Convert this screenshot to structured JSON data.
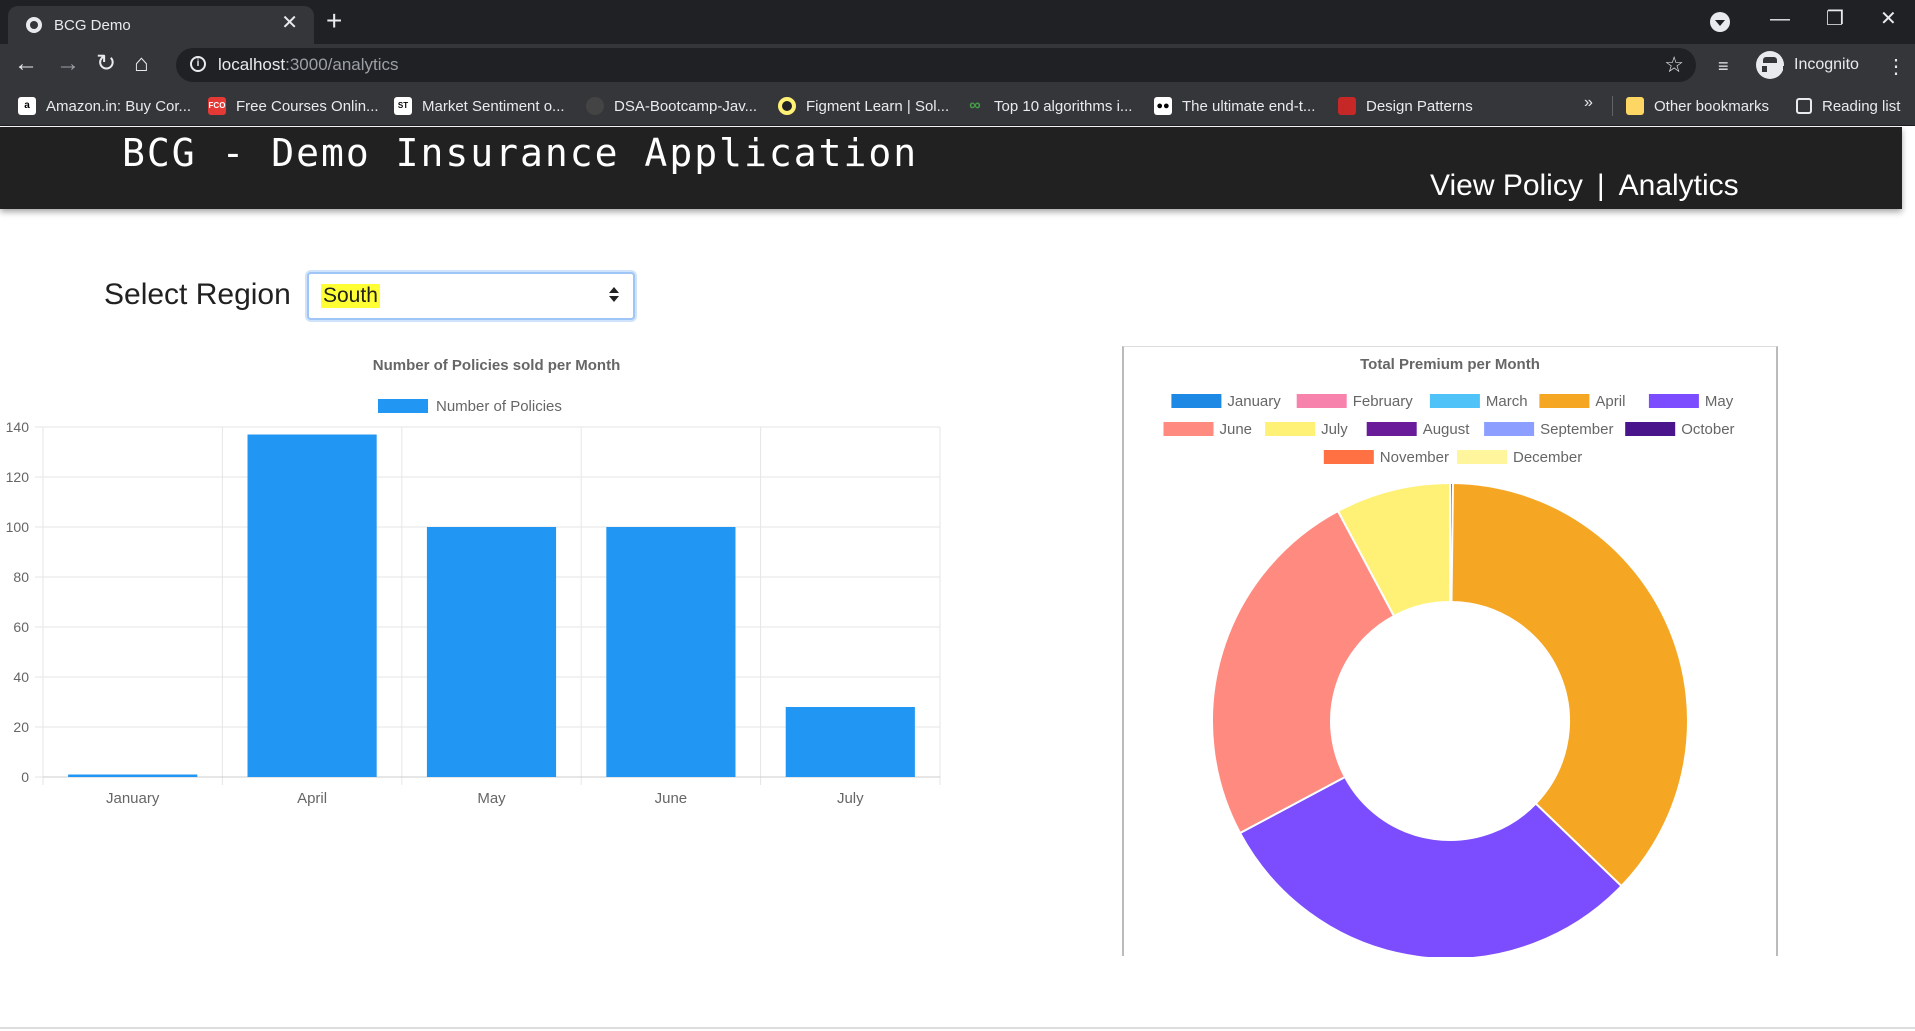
{
  "browser": {
    "tab_title": "BCG Demo",
    "url_host": "localhost",
    "url_path": ":3000/analytics",
    "profile_label": "Incognito",
    "bookmarks": [
      {
        "label": "Amazon.in: Buy Cor...",
        "icon": "amazon-icon",
        "color": "#ffffff"
      },
      {
        "label": "Free Courses Onlin...",
        "icon": "fco-icon",
        "color": "#e53935"
      },
      {
        "label": "Market Sentiment o...",
        "icon": "sentiment-icon",
        "color": "#ffffff"
      },
      {
        "label": "DSA-Bootcamp-Jav...",
        "icon": "github-icon",
        "color": "#444444"
      },
      {
        "label": "Figment Learn | Sol...",
        "icon": "figment-icon",
        "color": "#fff176"
      },
      {
        "label": "Top 10 algorithms i...",
        "icon": "infinity-icon",
        "color": "#2e7d32"
      },
      {
        "label": "The ultimate end-t...",
        "icon": "medium-icon",
        "color": "#ffffff"
      },
      {
        "label": "Design Patterns",
        "icon": "refactoring-icon",
        "color": "#c62828"
      }
    ],
    "more_bookmarks": "»",
    "other_bookmarks": "Other bookmarks",
    "reading_list": "Reading list"
  },
  "app": {
    "title": "BCG - Demo Insurance Application",
    "nav": {
      "view_policy": "View Policy",
      "separator": "|",
      "analytics": "Analytics"
    }
  },
  "filters": {
    "region_label": "Select Region",
    "region_value": "South"
  },
  "colors": {
    "bar": "#2196f3",
    "grid": "#e6e6e6",
    "text": "#666666"
  },
  "chart_data": [
    {
      "type": "bar",
      "title": "Number of Policies sold per Month",
      "categories": [
        "January",
        "April",
        "May",
        "June",
        "July"
      ],
      "series": [
        {
          "name": "Number of Policies",
          "values": [
            1,
            137,
            100,
            100,
            28
          ]
        }
      ],
      "ylim": [
        0,
        140
      ],
      "yticks": [
        0,
        20,
        40,
        60,
        80,
        100,
        120,
        140
      ],
      "grid": true,
      "legend": "top"
    },
    {
      "type": "pie",
      "title": "Total Premium per Month",
      "labels": [
        "January",
        "February",
        "March",
        "April",
        "May",
        "June",
        "July",
        "August",
        "September",
        "October",
        "November",
        "December"
      ],
      "values": [
        0.2,
        0,
        0,
        37,
        30,
        25,
        7.8,
        0,
        0,
        0,
        0,
        0
      ],
      "colors": [
        "#1e88e5",
        "#f783ac",
        "#4fc3f7",
        "#f5a623",
        "#7c4dff",
        "#ff8a80",
        "#fff176",
        "#6a1b9a",
        "#8c9eff",
        "#4a148c",
        "#ff7043",
        "#fff59d"
      ],
      "hole": 0.5,
      "legend": "top"
    }
  ]
}
